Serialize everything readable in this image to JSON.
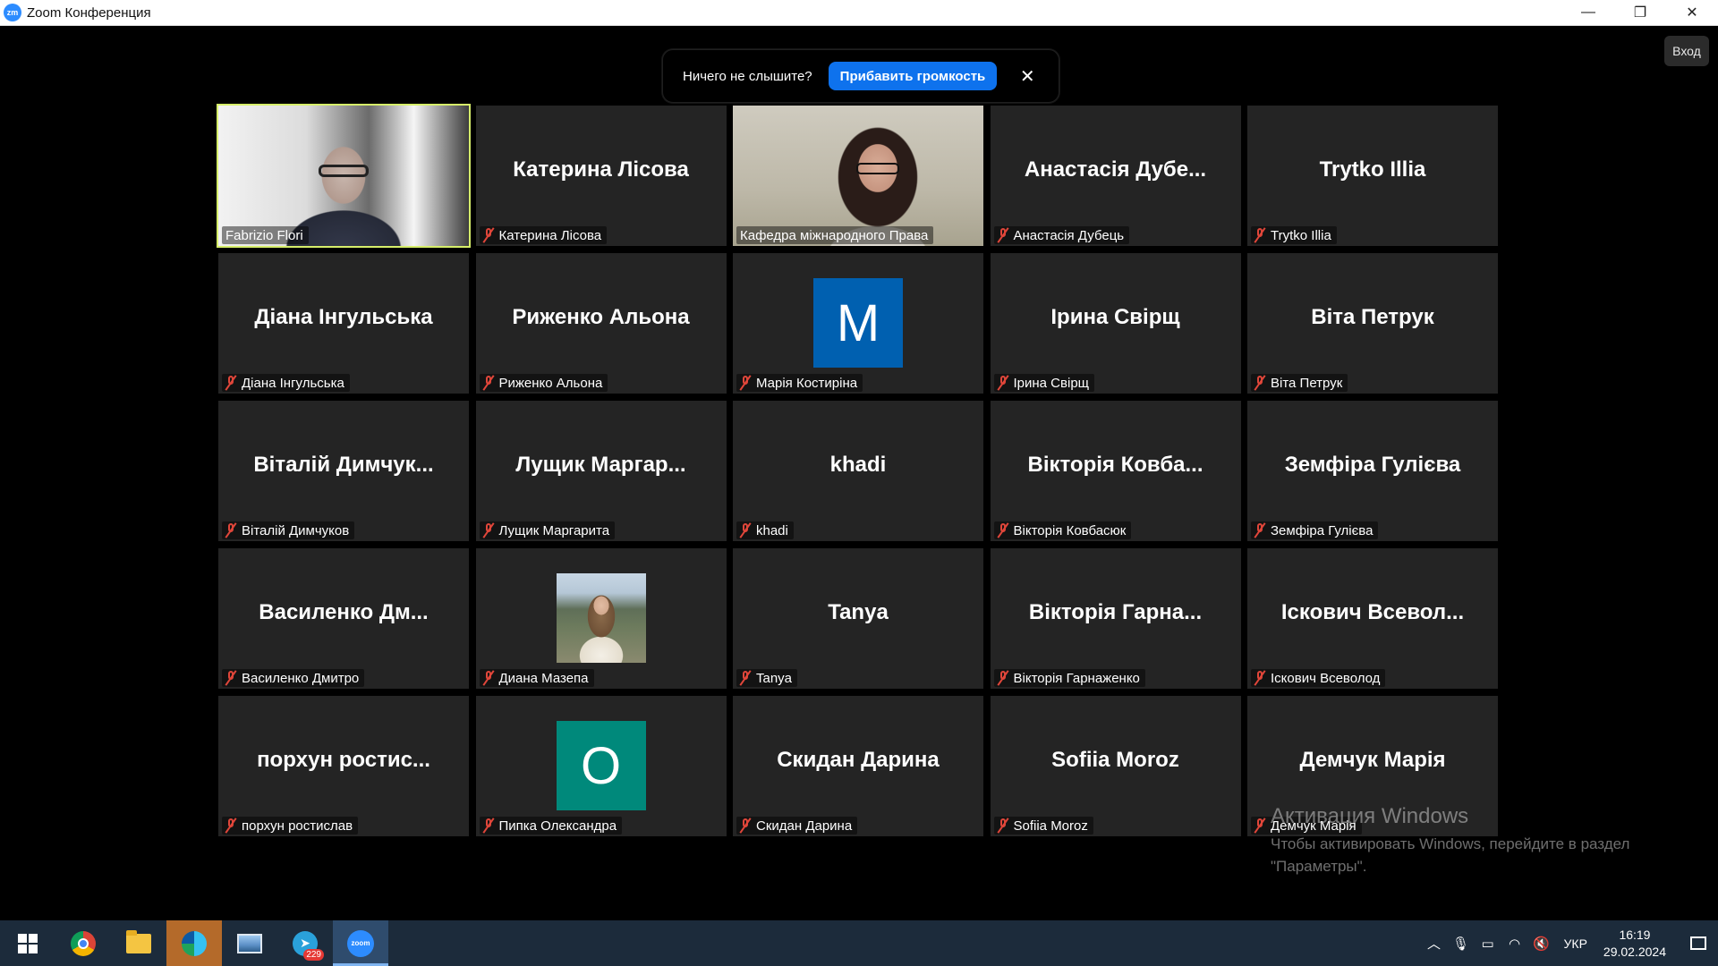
{
  "window": {
    "title": "Zoom Конференция",
    "app_icon_text": "zm",
    "controls": {
      "minimize": "—",
      "restore": "❐",
      "close": "✕"
    }
  },
  "top_right": {
    "login_label": "Вход"
  },
  "audio_banner": {
    "message": "Ничего не слышите?",
    "button_label": "Прибавить громкость",
    "close_glyph": "✕"
  },
  "colors": {
    "tile_bg": "#242424",
    "active_speaker_border": "#d6ee6a",
    "muted_icon": "#e0463a",
    "avatar_blue": "#0060b0",
    "avatar_teal": "#00897b",
    "primary_button": "#0e72ed"
  },
  "participants": [
    {
      "display": "",
      "label": "Fabrizio Flori",
      "muted": false,
      "video": "fabrizio",
      "active": true
    },
    {
      "display": "Катерина Лісова",
      "label": "Катерина Лісова",
      "muted": true
    },
    {
      "display": "",
      "label": "Кафедра міжнародного Права",
      "muted": false,
      "video": "kafedra"
    },
    {
      "display": "Анастасія Дубе...",
      "label": "Анастасія Дубець",
      "muted": true
    },
    {
      "display": "Trytko Illia",
      "label": "Trytko Illia",
      "muted": true
    },
    {
      "display": "Діана Інгульська",
      "label": "Діана Інгульська",
      "muted": true
    },
    {
      "display": "Риженко Альона",
      "label": "Риженко Альона",
      "muted": true
    },
    {
      "display": "",
      "label": "Марія Костиріна",
      "muted": true,
      "avatar_letter": "M",
      "avatar_color": "#0060b0"
    },
    {
      "display": "Ірина Свірщ",
      "label": "Ірина Свірщ",
      "muted": true
    },
    {
      "display": "Віта Петрук",
      "label": "Віта Петрук",
      "muted": true
    },
    {
      "display": "Віталій Димчук...",
      "label": "Віталій Димчуков",
      "muted": true
    },
    {
      "display": "Лущик Маргар...",
      "label": "Лущик Маргарита",
      "muted": true
    },
    {
      "display": "khadi",
      "label": "khadi",
      "muted": true
    },
    {
      "display": "Вікторія Ковба...",
      "label": "Вікторія Ковбасюк",
      "muted": true
    },
    {
      "display": "Земфіра Гулієва",
      "label": "Земфіра Гулієва",
      "muted": true
    },
    {
      "display": "Василенко Дм...",
      "label": "Василенко Дмитро",
      "muted": true
    },
    {
      "display": "",
      "label": "Диана Мазепа",
      "muted": true,
      "photo": "dyana"
    },
    {
      "display": "Tanya",
      "label": "Tanya",
      "muted": true
    },
    {
      "display": "Вікторія Гарна...",
      "label": "Вікторія Гарнаженко",
      "muted": true
    },
    {
      "display": "Іскович Всевол...",
      "label": "Іскович Всеволод",
      "muted": true
    },
    {
      "display": "порхун ростис...",
      "label": "порхун ростислав",
      "muted": true
    },
    {
      "display": "",
      "label": "Пипка Олександра",
      "muted": true,
      "avatar_letter": "O",
      "avatar_color": "#00897b"
    },
    {
      "display": "Скидан Дарина",
      "label": "Скидан Дарина",
      "muted": true
    },
    {
      "display": "Sofiia Moroz",
      "label": "Sofiia Moroz",
      "muted": true
    },
    {
      "display": "Демчук Марія",
      "label": "Демчук Марія",
      "muted": true
    }
  ],
  "activation": {
    "title": "Активация Windows",
    "text": "Чтобы активировать Windows, перейдите в раздел \"Параметры\"."
  },
  "taskbar": {
    "items": [
      {
        "name": "start-button",
        "icon": "windows-logo-icon"
      },
      {
        "name": "taskbar-chrome",
        "icon": "chrome-icon"
      },
      {
        "name": "taskbar-file-explorer",
        "icon": "folder-icon"
      },
      {
        "name": "taskbar-edge",
        "icon": "edge-icon"
      },
      {
        "name": "taskbar-photos",
        "icon": "photos-icon"
      },
      {
        "name": "taskbar-telegram",
        "icon": "telegram-icon",
        "badge": "229"
      },
      {
        "name": "taskbar-zoom",
        "icon": "zoom-icon",
        "label": "zoom"
      }
    ],
    "tray": {
      "language": "УКР",
      "time": "16:19",
      "date": "29.02.2024"
    }
  }
}
